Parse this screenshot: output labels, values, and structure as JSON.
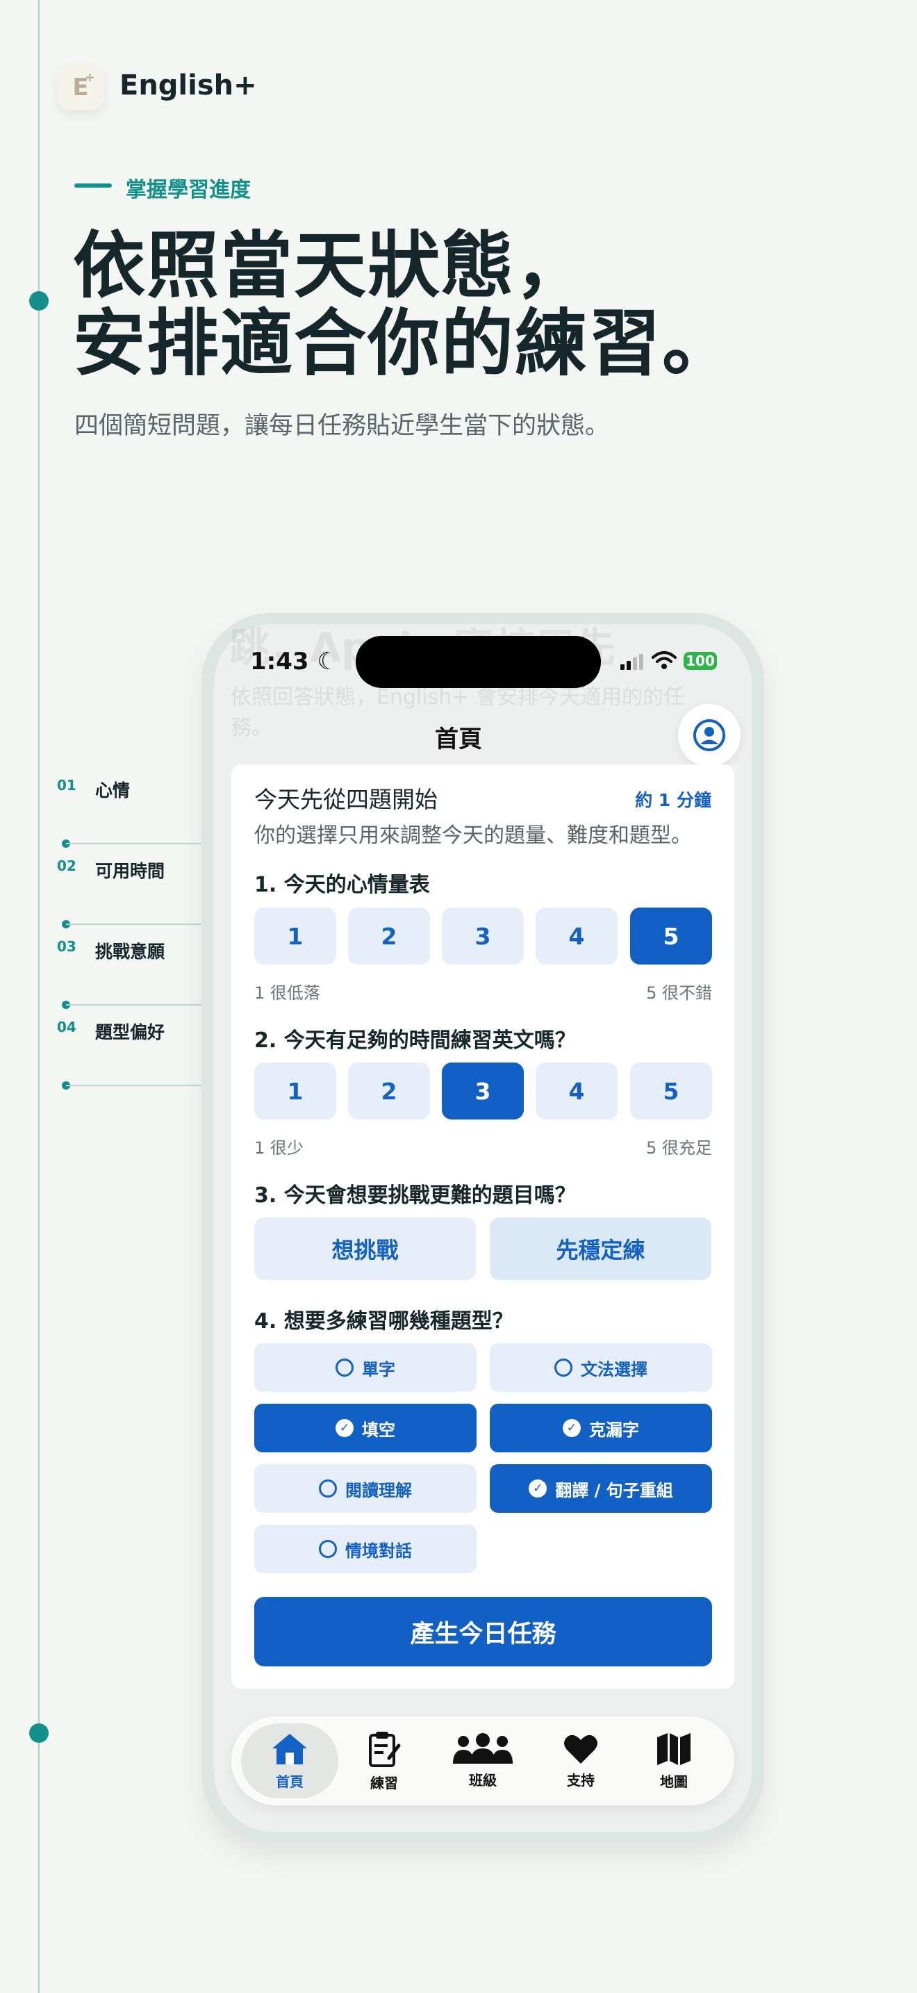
{
  "brand": {
    "name": "English+",
    "logo_letter": "E",
    "logo_plus": "+"
  },
  "hero": {
    "eyebrow": "掌握學習進度",
    "headline_line1": "依照當天狀態，",
    "headline_line2": "安排適合你的練習。",
    "subtitle": "四個簡短問題，讓每日任務貼近學生當下的狀態。"
  },
  "steps": [
    {
      "num": "01",
      "label": "心情"
    },
    {
      "num": "02",
      "label": "可用時間"
    },
    {
      "num": "03",
      "label": "挑戰意願"
    },
    {
      "num": "04",
      "label": "題型偏好"
    }
  ],
  "status_bar": {
    "time": "1:43",
    "battery": "100"
  },
  "ghost": {
    "title": "跳，Apple 審核用先",
    "subtitle": "依照回答狀態，English+ 會安排今天適用的的任務。"
  },
  "nav": {
    "title": "首頁"
  },
  "card": {
    "title": "今天先從四題開始",
    "time": "約 1 分鐘",
    "desc": "你的選擇只用來調整今天的題量、難度和題型。"
  },
  "q1": {
    "text": "1. 今天的心情量表",
    "options": [
      "1",
      "2",
      "3",
      "4",
      "5"
    ],
    "selected": "5",
    "low": "1 很低落",
    "high": "5 很不錯"
  },
  "q2": {
    "text": "2. 今天有足夠的時間練習英文嗎？",
    "options": [
      "1",
      "2",
      "3",
      "4",
      "5"
    ],
    "selected": "3",
    "low": "1 很少",
    "high": "5 很充足"
  },
  "q3": {
    "text": "3. 今天會想要挑戰更難的題目嗎？",
    "options": [
      "想挑戰",
      "先穩定練"
    ]
  },
  "q4": {
    "text": "4. 想要多練習哪幾種題型？",
    "options": [
      {
        "label": "單字",
        "selected": false
      },
      {
        "label": "文法選擇",
        "selected": false
      },
      {
        "label": "填空",
        "selected": true
      },
      {
        "label": "克漏字",
        "selected": true
      },
      {
        "label": "閱讀理解",
        "selected": false
      },
      {
        "label": "翻譯 / 句子重組",
        "selected": true
      },
      {
        "label": "情境對話",
        "selected": false
      }
    ]
  },
  "cta": {
    "label": "產生今日任務"
  },
  "tabs": [
    {
      "label": "首頁",
      "icon": "home-icon",
      "active": true
    },
    {
      "label": "練習",
      "icon": "clipboard-icon",
      "active": false
    },
    {
      "label": "班級",
      "icon": "group-icon",
      "active": false
    },
    {
      "label": "支持",
      "icon": "heart-icon",
      "active": false
    },
    {
      "label": "地圖",
      "icon": "map-icon",
      "active": false
    }
  ],
  "colors": {
    "accent": "#12908a",
    "primary": "#1160c6",
    "background": "#f4f6f3"
  }
}
